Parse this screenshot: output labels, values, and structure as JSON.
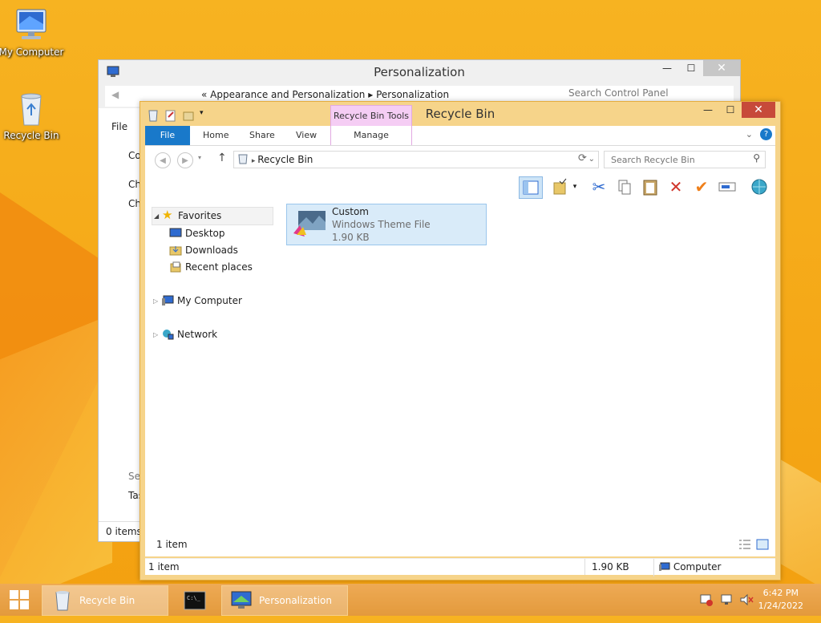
{
  "desktop": {
    "icons": [
      {
        "label": "My Computer"
      },
      {
        "label": "Recycle Bin"
      }
    ]
  },
  "personalization_window": {
    "title": "Personalization",
    "address": {
      "part1": "Appearance and Personalization",
      "part2": "Personalization"
    },
    "search_placeholder": "Search Control Panel",
    "menu_file": "File",
    "side_fragments": [
      "Co",
      "Ch",
      "Ch",
      "See",
      "Tas"
    ],
    "status": "0 items"
  },
  "recycle_window": {
    "title": "Recycle Bin",
    "context_tab": "Recycle Bin Tools",
    "ribbon_tabs": [
      "File",
      "Home",
      "Share",
      "View",
      "Manage"
    ],
    "address": "Recycle Bin",
    "search_placeholder": "Search Recycle Bin",
    "tree": {
      "favorites": "Favorites",
      "desktop": "Desktop",
      "downloads": "Downloads",
      "recent": "Recent places",
      "computer": "My Computer",
      "network": "Network"
    },
    "item": {
      "name": "Custom",
      "type": "Windows Theme File",
      "size": "1.90 KB"
    },
    "inner_status": "1 item",
    "status": {
      "items": "1 item",
      "size": "1.90 KB",
      "location": "Computer"
    }
  },
  "taskbar": {
    "tasks": [
      {
        "label": "Recycle Bin"
      },
      {
        "label": "Personalization"
      }
    ],
    "time": "6:42 PM",
    "date": "1/24/2022"
  },
  "colors": {
    "accent": "#1979ca",
    "close_red": "#c74a3a",
    "context_tab": "#f5cdf4",
    "window_frame": "#f6d48a"
  }
}
